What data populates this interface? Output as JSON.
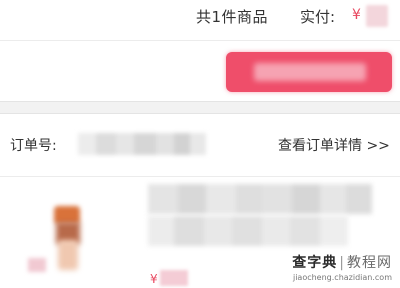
{
  "order_summary": {
    "item_count_text": "共1件商品",
    "paid_label": "实付:",
    "currency_symbol": "¥"
  },
  "order_info": {
    "order_number_label": "订单号:",
    "details_link_text": "查看订单详情 >>"
  },
  "product": {
    "currency_symbol": "¥"
  },
  "watermark": {
    "brand_left": "查字典",
    "brand_right": "教程网",
    "url": "jiaocheng.chazidian.com"
  },
  "colors": {
    "accent": "#ef4e6a",
    "price_text": "#e8475f",
    "section_gap": "#f2f2f2"
  }
}
